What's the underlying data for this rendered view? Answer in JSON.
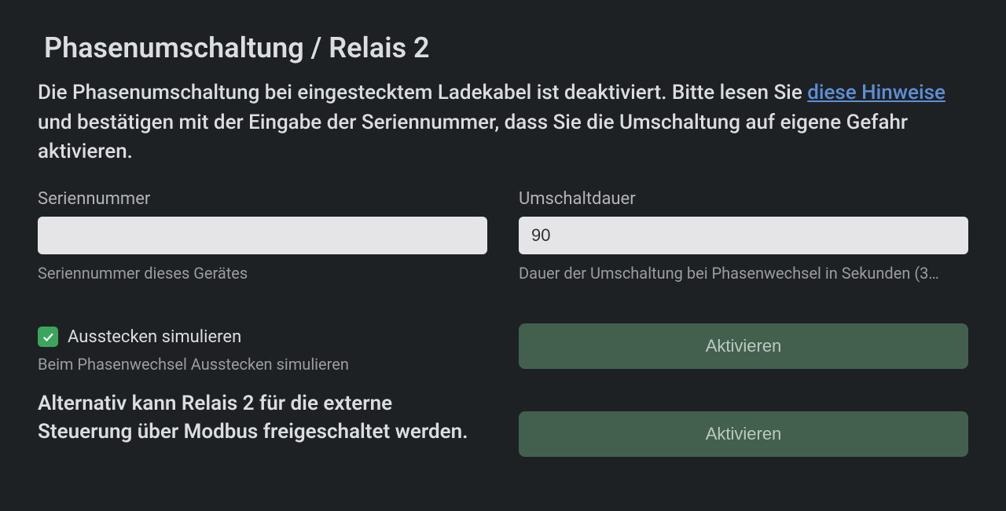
{
  "title": "Phasenumschaltung / Relais 2",
  "description": {
    "part1": "Die Phasenumschaltung bei eingestecktem Ladekabel ist deaktiviert. Bitte lesen Sie ",
    "link_text": "diese Hinweise",
    "part2": " und bestätigen mit der Eingabe der Seriennummer, dass Sie die Umschaltung auf eigene Gefahr aktivieren."
  },
  "fields": {
    "serial": {
      "label": "Seriennummer",
      "value": "",
      "help": "Seriennummer dieses Gerätes"
    },
    "duration": {
      "label": "Umschaltdauer",
      "value": "90",
      "help": "Dauer der Umschaltung bei Phasenwechsel in Sekunden (3…"
    }
  },
  "checkbox": {
    "label": "Ausstecken simulieren",
    "help": "Beim Phasenwechsel Ausstecken simulieren",
    "checked": true
  },
  "alternative_text": "Alternativ kann Relais 2 für die externe Steuerung über Modbus freigeschaltet werden.",
  "buttons": {
    "activate1": "Aktivieren",
    "activate2": "Aktivieren"
  }
}
